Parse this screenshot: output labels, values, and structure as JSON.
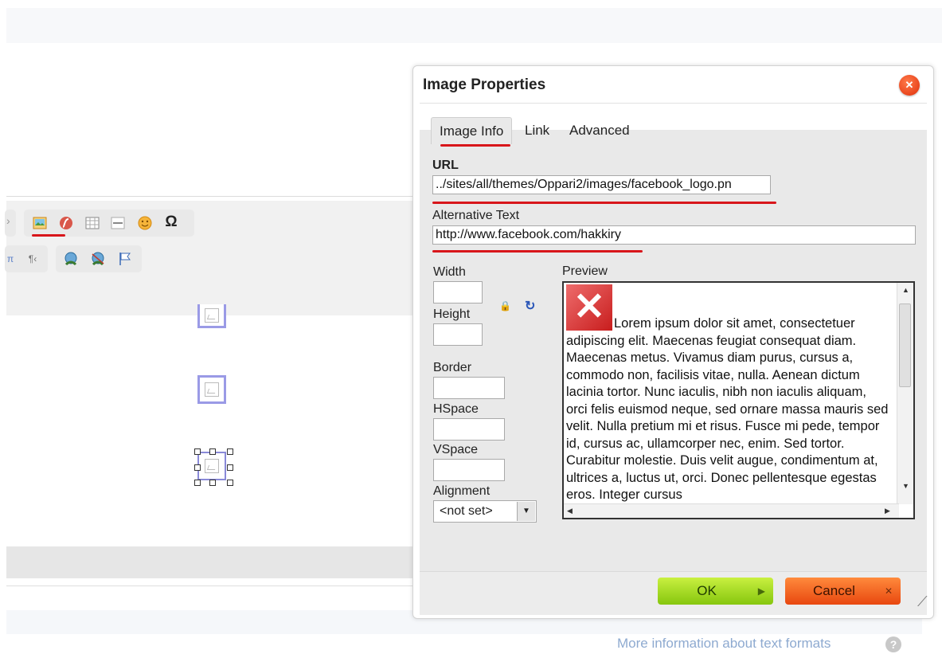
{
  "background_editor": {
    "toolbar_row1": [
      {
        "icon": "image-icon",
        "color": "#e08a1c"
      },
      {
        "icon": "flash-icon",
        "color": "#d65a4a"
      },
      {
        "icon": "table-icon",
        "color": "#7a7a7a"
      },
      {
        "icon": "horizontal-line-icon",
        "color": "#9a9a9a"
      },
      {
        "icon": "smiley-icon",
        "color": "#f0a030"
      },
      {
        "icon": "special-char-icon",
        "glyph": "Ω",
        "color": "#3a6ab8"
      }
    ],
    "toolbar_row2": [
      {
        "icon": "rtl-icon",
        "glyph": "¶‹",
        "color": "#777777"
      },
      {
        "icon": "link-icon",
        "color": "#3a7a30"
      },
      {
        "icon": "unlink-icon",
        "color": "#3a7a30"
      },
      {
        "icon": "anchor-flag-icon",
        "color": "#3a6ab8"
      }
    ],
    "more_info": "More information about text formats",
    "help_glyph": "?"
  },
  "dialog": {
    "title": "Image Properties",
    "close_glyph": "✕",
    "tabs": [
      {
        "label": "Image Info",
        "active": true
      },
      {
        "label": "Link",
        "active": false
      },
      {
        "label": "Advanced",
        "active": false
      }
    ],
    "url_label": "URL",
    "url_value": "../sites/all/themes/Oppari2/images/facebook_logo.pn",
    "alt_label": "Alternative Text",
    "alt_value": "http://www.facebook.com/hakkiry",
    "width_label": "Width",
    "height_label": "Height",
    "border_label": "Border",
    "hspace_label": "HSpace",
    "vspace_label": "VSpace",
    "alignment_label": "Alignment",
    "alignment_value": "<not set>",
    "preview_label": "Preview",
    "preview_text": "Lorem ipsum dolor sit amet, consectetuer adipiscing elit. Maecenas feugiat consequat diam. Maecenas metus. Vivamus diam purus, cursus a, commodo non, facilisis vitae, nulla. Aenean dictum lacinia tortor. Nunc iaculis, nibh non iaculis aliquam, orci felis euismod neque, sed ornare massa mauris sed velit. Nulla pretium mi et risus. Fusce mi pede, tempor id, cursus ac, ullamcorper nec, enim. Sed tortor. Curabitur molestie. Duis velit augue, condimentum at, ultrices a, luctus ut, orci. Donec pellentesque egestas eros. Integer cursus",
    "ok_label": "OK",
    "cancel_label": "Cancel",
    "ok_color": "#9ad620",
    "cancel_color": "#f0621f",
    "annotation_color": "#d8161b"
  }
}
